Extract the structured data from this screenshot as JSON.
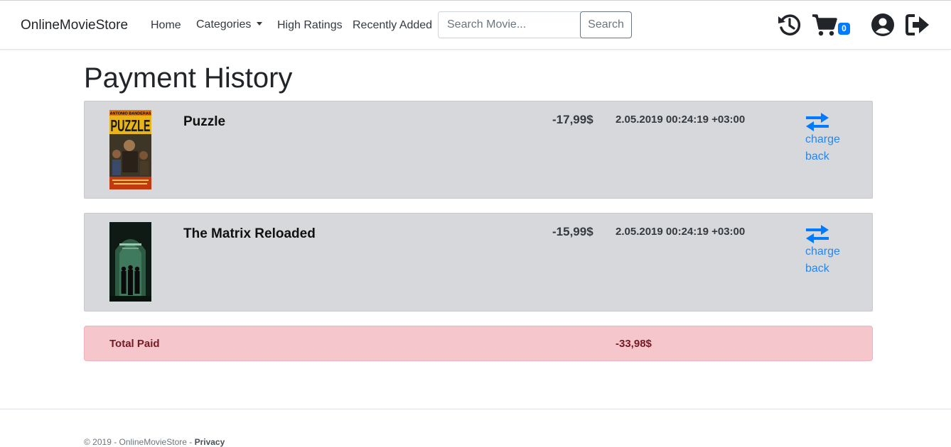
{
  "nav": {
    "brand": "OnlineMovieStore",
    "links": [
      "Home",
      "Categories",
      "High Ratings",
      "Recently Added"
    ],
    "search_placeholder": "Search Movie...",
    "search_button": "Search",
    "cart_count": "0",
    "icons": [
      "history-icon",
      "cart-icon",
      "user-icon",
      "logout-icon"
    ]
  },
  "page": {
    "title": "Payment History"
  },
  "payments": [
    {
      "title": "Puzzle",
      "price": "-17,99$",
      "date": "2.05.2019 00:24:19 +03:00",
      "action": "charge back",
      "poster_text": "ANTONIO BANDERAS"
    },
    {
      "title": "The Matrix Reloaded",
      "price": "-15,99$",
      "date": "2.05.2019 00:24:19 +03:00",
      "action": "charge back"
    }
  ],
  "total": {
    "label": "Total Paid",
    "value": "-33,98$"
  },
  "footer": {
    "text": "© 2019 - OnlineMovieStore - ",
    "link": "Privacy"
  },
  "colors": {
    "accent": "#007bff",
    "card_bg": "#d6d8db",
    "total_bg": "#f5c6cb",
    "total_text": "#721c24"
  }
}
